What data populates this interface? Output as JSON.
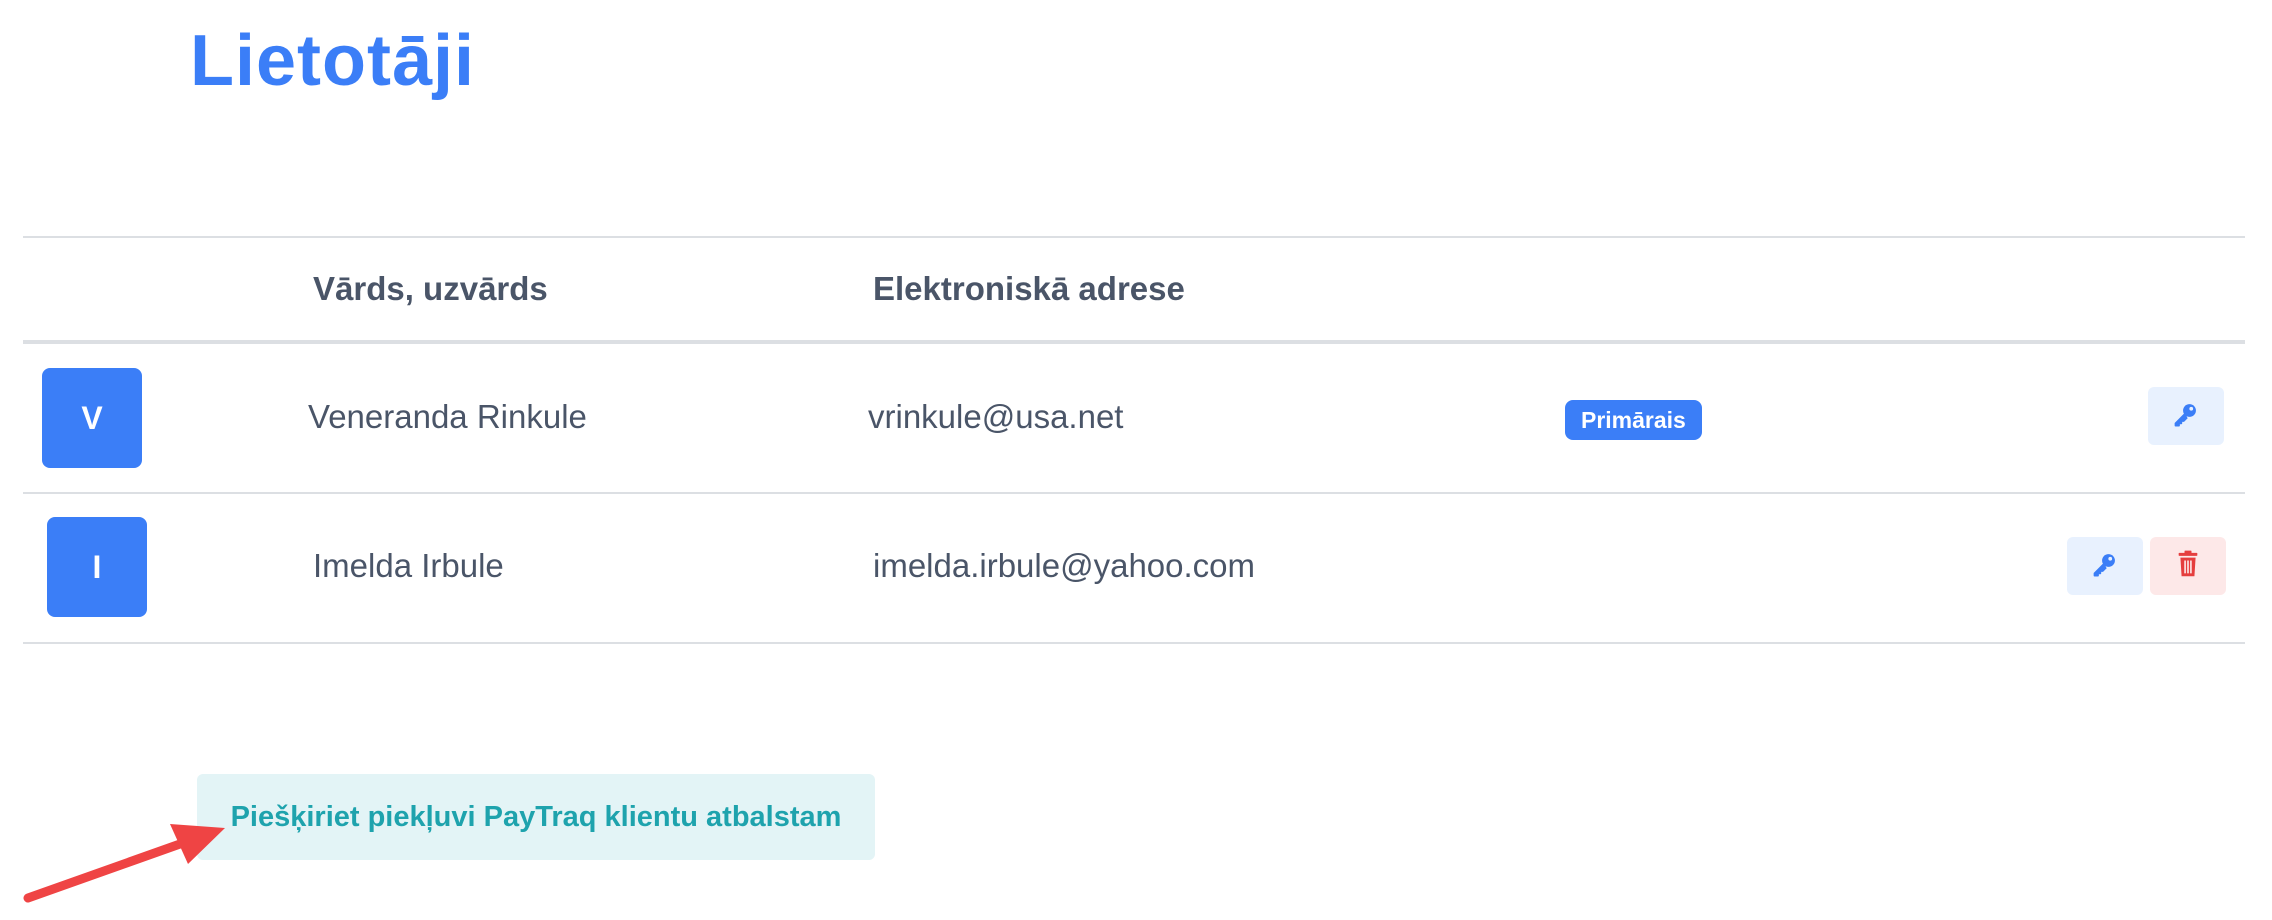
{
  "page": {
    "title": "Lietotāji"
  },
  "table": {
    "columns": {
      "name": "Vārds, uzvārds",
      "email": "Elektroniskā adrese"
    },
    "rows": [
      {
        "initial": "V",
        "name": "Veneranda Rinkule",
        "email": "vrinkule@usa.net",
        "badge": "Primārais",
        "actions": [
          "key-icon"
        ]
      },
      {
        "initial": "I",
        "name": "Imelda Irbule",
        "email": "imelda.irbule@yahoo.com",
        "badge": "",
        "actions": [
          "key-icon",
          "trash-icon"
        ]
      }
    ]
  },
  "support": {
    "label": "Piešķiriet piekļuvi PayTraq klientu atbalstam"
  },
  "colors": {
    "accent": "#3b7ef7",
    "danger": "#e53e3e",
    "support_text": "#1ea3ad",
    "annotation_arrow": "#ef4444"
  }
}
